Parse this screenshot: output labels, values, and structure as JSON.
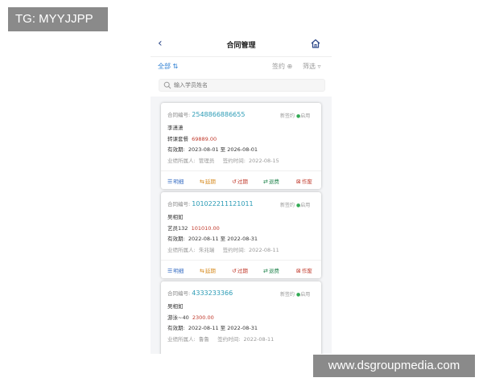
{
  "watermarks": {
    "top_left": "TG: MYYJJPP",
    "bottom_right": "www.dsgroupmedia.com"
  },
  "nav": {
    "title": "合同管理",
    "back_icon": "chevron-left-icon",
    "home_icon": "home-icon"
  },
  "filter": {
    "all_label": "全部",
    "sort_icon": "sort-icon",
    "sign_label": "签约",
    "screen_label": "筛选"
  },
  "search": {
    "placeholder": "输入学员姓名"
  },
  "cards": [
    {
      "contract_label": "合同编号:",
      "contract_no": "2548866886655",
      "status_new": "新签约",
      "status_active": "启用",
      "student": "李潇潇",
      "course": "转课套餐",
      "price": "69889.00",
      "valid_label": "有效期:",
      "valid_range": "2023-08-01 至 2026-08-01",
      "owner_label": "业绩所属人:",
      "owner": "管理员",
      "signed_label": "签约时间:",
      "signed_at": "2022-08-15"
    },
    {
      "contract_label": "合同编号:",
      "contract_no": "101022211121011",
      "status_new": "新签约",
      "status_active": "启用",
      "student": "吴相如",
      "course": "艺员132",
      "price": "101010.00",
      "valid_label": "有效期:",
      "valid_range": "2022-08-11 至 2022-08-31",
      "owner_label": "业绩所属人:",
      "owner": "朱兆瑞",
      "signed_label": "签约时间:",
      "signed_at": "2022-08-11"
    },
    {
      "contract_label": "合同编号:",
      "contract_no": "4333233366",
      "status_new": "新签约",
      "status_active": "启用",
      "student": "吴相如",
      "course": "游泳~40",
      "price": "2300.00",
      "valid_label": "有效期:",
      "valid_range": "2022-08-11 至 2022-08-31",
      "owner_label": "业绩所属人:",
      "owner": "鲁鲁",
      "signed_label": "签约时间:",
      "signed_at": "2022-08-11"
    }
  ],
  "actions": {
    "detail": "明细",
    "extend": "延期",
    "expire": "过期",
    "refund": "退费",
    "void": "作废"
  },
  "colors": {
    "accent": "#2d7fd3",
    "contract_no": "#2b9bb5",
    "price": "#c0392b",
    "active_dot": "#33aa55"
  }
}
